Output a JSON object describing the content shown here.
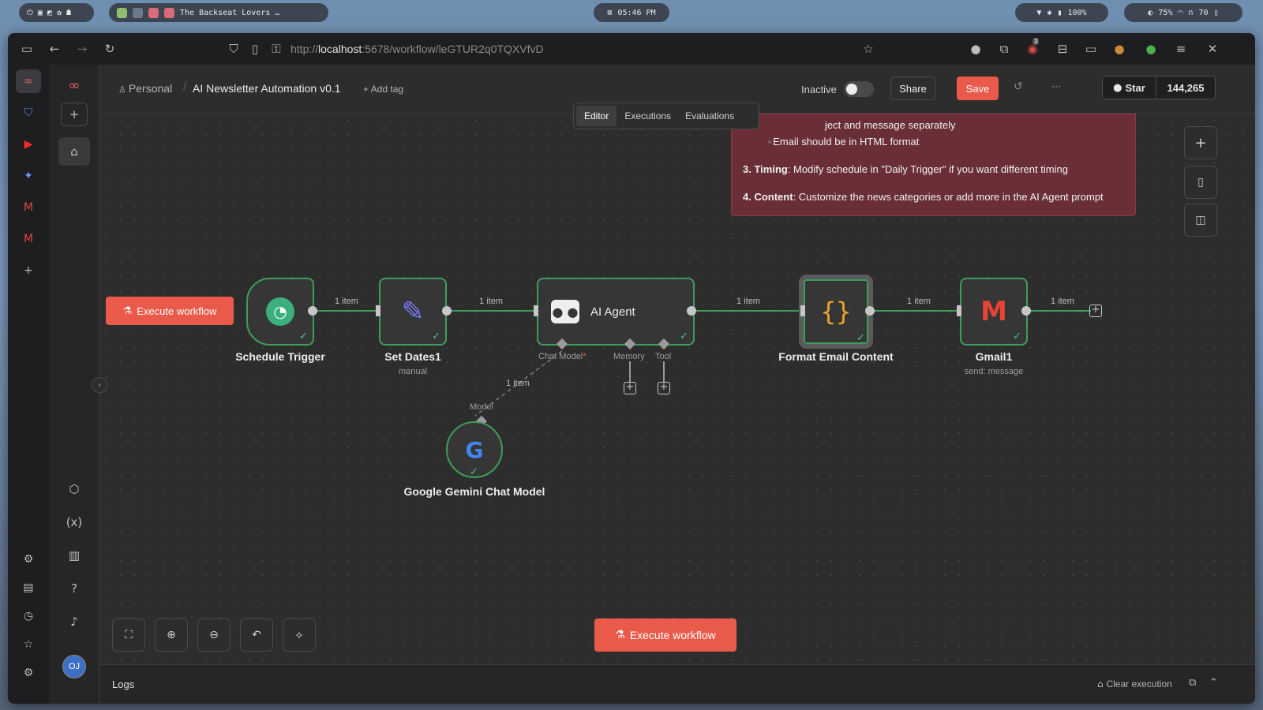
{
  "os": {
    "left_indicators": "⏻ ▣ ◩ ✿ ☗",
    "task": "The Backseat Lovers …",
    "clock": "05:46 PM",
    "clock_icon": "⊠",
    "battery": "100%",
    "volume": "75%",
    "wifi": "70"
  },
  "browser": {
    "url_prefix": "http://",
    "url_host": "localhost",
    "url_rest": ":5678/workflow/leGTUR2q0TQXVfvD",
    "ext_badge": "3"
  },
  "header": {
    "project": "Personal",
    "workflow_name": "AI Newsletter Automation v0.1",
    "add_tag": "+ Add tag",
    "status": "Inactive",
    "share": "Share",
    "save": "Save",
    "more": "···",
    "star_label": "Star",
    "star_count": "144,265",
    "tabs": [
      "Editor",
      "Executions",
      "Evaluations"
    ]
  },
  "sticky": {
    "line1": "ject and message separately",
    "line2": "Email should be in HTML format",
    "line3_bold": "3. Timing",
    "line3_text": ": Modify schedule in \"Daily Trigger\" if you want different timing",
    "line4_bold": "4. Content",
    "line4_text": ": Customize the news categories or add more in the AI Agent prompt"
  },
  "nodes": {
    "schedule": {
      "label": "Schedule Trigger"
    },
    "setdates": {
      "label": "Set Dates1",
      "sub": "manual"
    },
    "agent": {
      "label": "AI Agent",
      "chat_model": "Chat Model",
      "required": "*",
      "memory": "Memory",
      "tool": "Tool"
    },
    "format": {
      "label": "Format Email Content"
    },
    "gmail": {
      "label": "Gmail1",
      "sub": "send: message"
    },
    "gemini": {
      "label": "Google Gemini Chat Model",
      "port": "Model"
    }
  },
  "item_label": "1 item",
  "execute": "Execute workflow",
  "logs": {
    "title": "Logs",
    "clear": "Clear execution"
  },
  "avatar": "OJ",
  "colors": {
    "accent": "#ea5a4a",
    "node_border": "#3f9d5c",
    "sticky": "#6a2f36"
  }
}
